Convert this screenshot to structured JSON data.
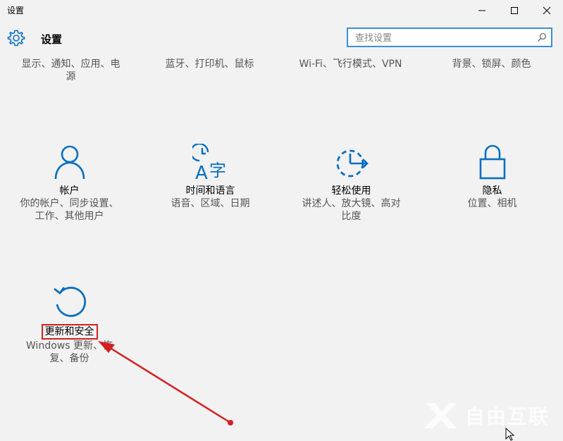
{
  "window": {
    "title": "设置"
  },
  "header": {
    "title": "设置",
    "search_placeholder": "查找设置"
  },
  "top_items": [
    {
      "desc": "显示、通知、应用、电\n源"
    },
    {
      "desc": "蓝牙、打印机、鼠标"
    },
    {
      "desc": "Wi-Fi、飞行模式、VPN"
    },
    {
      "desc": "背景、锁屏、颜色"
    }
  ],
  "tiles": [
    {
      "label": "帐户",
      "desc": "你的帐户、同步设置、\n工作、其他用户",
      "icon": "person-icon"
    },
    {
      "label": "时间和语言",
      "desc": "语音、区域、日期",
      "icon": "time-language-icon"
    },
    {
      "label": "轻松使用",
      "desc": "讲述人、放大镜、高对\n比度",
      "icon": "ease-of-access-icon"
    },
    {
      "label": "隐私",
      "desc": "位置、相机",
      "icon": "lock-icon"
    },
    {
      "label": "更新和安全",
      "desc": "Windows 更新、恢\n复、备份",
      "icon": "refresh-icon"
    }
  ],
  "colors": {
    "accent": "#0a6fc2",
    "annotation": "#d42020",
    "background": "#f2f2f2"
  },
  "watermark": {
    "text": "自由互联"
  }
}
